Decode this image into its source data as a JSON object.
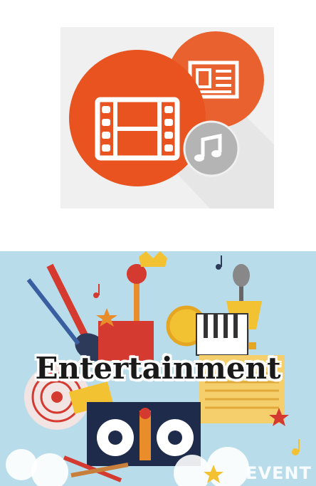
{
  "icon_tile": {
    "icons": [
      "film-strip-icon",
      "newspaper-icon",
      "music-note-icon"
    ],
    "colors": {
      "tile_background": "#f0f0f0",
      "large_circle": "#e8531f",
      "small_circle": "#e8612f",
      "music_circle": "#b4b4b4",
      "glyph": "#ffffff"
    }
  },
  "banner": {
    "title": "Entertainment",
    "watermark": "EVENT",
    "background_color": "#b9dcea",
    "icons": [
      "electric-guitar-icon",
      "microphone-icon",
      "trophy-icon",
      "piano-keys-icon",
      "dj-mixer-icon",
      "vinyl-record-icon",
      "music-note-icon",
      "star-icon",
      "crown-icon",
      "drumstick-icon"
    ]
  }
}
